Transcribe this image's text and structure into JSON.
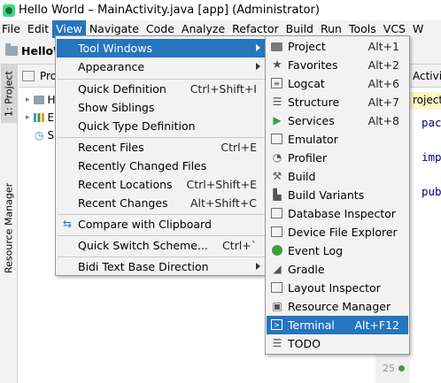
{
  "window": {
    "title": "Hello World – MainActivity.java [app] (Administrator)"
  },
  "menubar": {
    "items": [
      {
        "label": "File"
      },
      {
        "label": "Edit"
      },
      {
        "label": "View"
      },
      {
        "label": "Navigate"
      },
      {
        "label": "Code"
      },
      {
        "label": "Analyze"
      },
      {
        "label": "Refactor"
      },
      {
        "label": "Build"
      },
      {
        "label": "Run"
      },
      {
        "label": "Tools"
      },
      {
        "label": "VCS"
      },
      {
        "label": "W"
      }
    ],
    "active": "View"
  },
  "navbar": {
    "crumb": "HelloW"
  },
  "left_strip": {
    "project_tab": "1: Project",
    "resource_tab": "Resource Manager"
  },
  "project_panel": {
    "header": "Pro",
    "rows": [
      {
        "label": "H"
      },
      {
        "label": "E"
      },
      {
        "label": "S"
      }
    ]
  },
  "editor": {
    "tab": "Activity",
    "file_label": "roject",
    "code": [
      {
        "text": "pac"
      },
      {
        "text": "imp"
      },
      {
        "text": "pub"
      }
    ]
  },
  "gutter": {
    "line": "25"
  },
  "view_menu": {
    "items": [
      {
        "label": "Tool Windows",
        "shortcut": "",
        "submenu": true
      },
      {
        "label": "Appearance",
        "shortcut": "",
        "submenu": true
      },
      {
        "label": "Quick Definition",
        "shortcut": "Ctrl+Shift+I"
      },
      {
        "label": "Show Siblings",
        "shortcut": ""
      },
      {
        "label": "Quick Type Definition",
        "shortcut": ""
      },
      {
        "label": "Recent Files",
        "shortcut": "Ctrl+E"
      },
      {
        "label": "Recently Changed Files",
        "shortcut": ""
      },
      {
        "label": "Recent Locations",
        "shortcut": "Ctrl+Shift+E"
      },
      {
        "label": "Recent Changes",
        "shortcut": "Alt+Shift+C"
      },
      {
        "label": "Compare with Clipboard",
        "shortcut": ""
      },
      {
        "label": "Quick Switch Scheme...",
        "shortcut": "Ctrl+`"
      },
      {
        "label": "Bidi Text Base Direction",
        "shortcut": "",
        "submenu": true
      }
    ]
  },
  "tool_windows_menu": {
    "items": [
      {
        "label": "Project",
        "shortcut": "Alt+1",
        "icon": "folder-icon"
      },
      {
        "label": "Favorites",
        "shortcut": "Alt+2",
        "icon": "star-icon"
      },
      {
        "label": "Logcat",
        "shortcut": "Alt+6",
        "icon": "logcat-icon"
      },
      {
        "label": "Structure",
        "shortcut": "Alt+7",
        "icon": "structure-icon"
      },
      {
        "label": "Services",
        "shortcut": "Alt+8",
        "icon": "services-icon"
      },
      {
        "label": "Emulator",
        "shortcut": "",
        "icon": "emulator-icon"
      },
      {
        "label": "Profiler",
        "shortcut": "",
        "icon": "profiler-icon"
      },
      {
        "label": "Build",
        "shortcut": "",
        "icon": "hammer-icon"
      },
      {
        "label": "Build Variants",
        "shortcut": "",
        "icon": "build-variants-icon"
      },
      {
        "label": "Database Inspector",
        "shortcut": "",
        "icon": "database-icon"
      },
      {
        "label": "Device File Explorer",
        "shortcut": "",
        "icon": "device-file-icon"
      },
      {
        "label": "Event Log",
        "shortcut": "",
        "icon": "event-log-icon"
      },
      {
        "label": "Gradle",
        "shortcut": "",
        "icon": "gradle-icon"
      },
      {
        "label": "Layout Inspector",
        "shortcut": "",
        "icon": "layout-inspector-icon"
      },
      {
        "label": "Resource Manager",
        "shortcut": "",
        "icon": "resource-manager-icon"
      },
      {
        "label": "Terminal",
        "shortcut": "Alt+F12",
        "icon": "terminal-icon"
      },
      {
        "label": "TODO",
        "shortcut": "",
        "icon": "todo-icon"
      }
    ],
    "highlighted": "Terminal"
  },
  "colors": {
    "highlight": "#2675bf",
    "menu_bg": "#f2f2f2",
    "android_green": "#3ddc84"
  }
}
